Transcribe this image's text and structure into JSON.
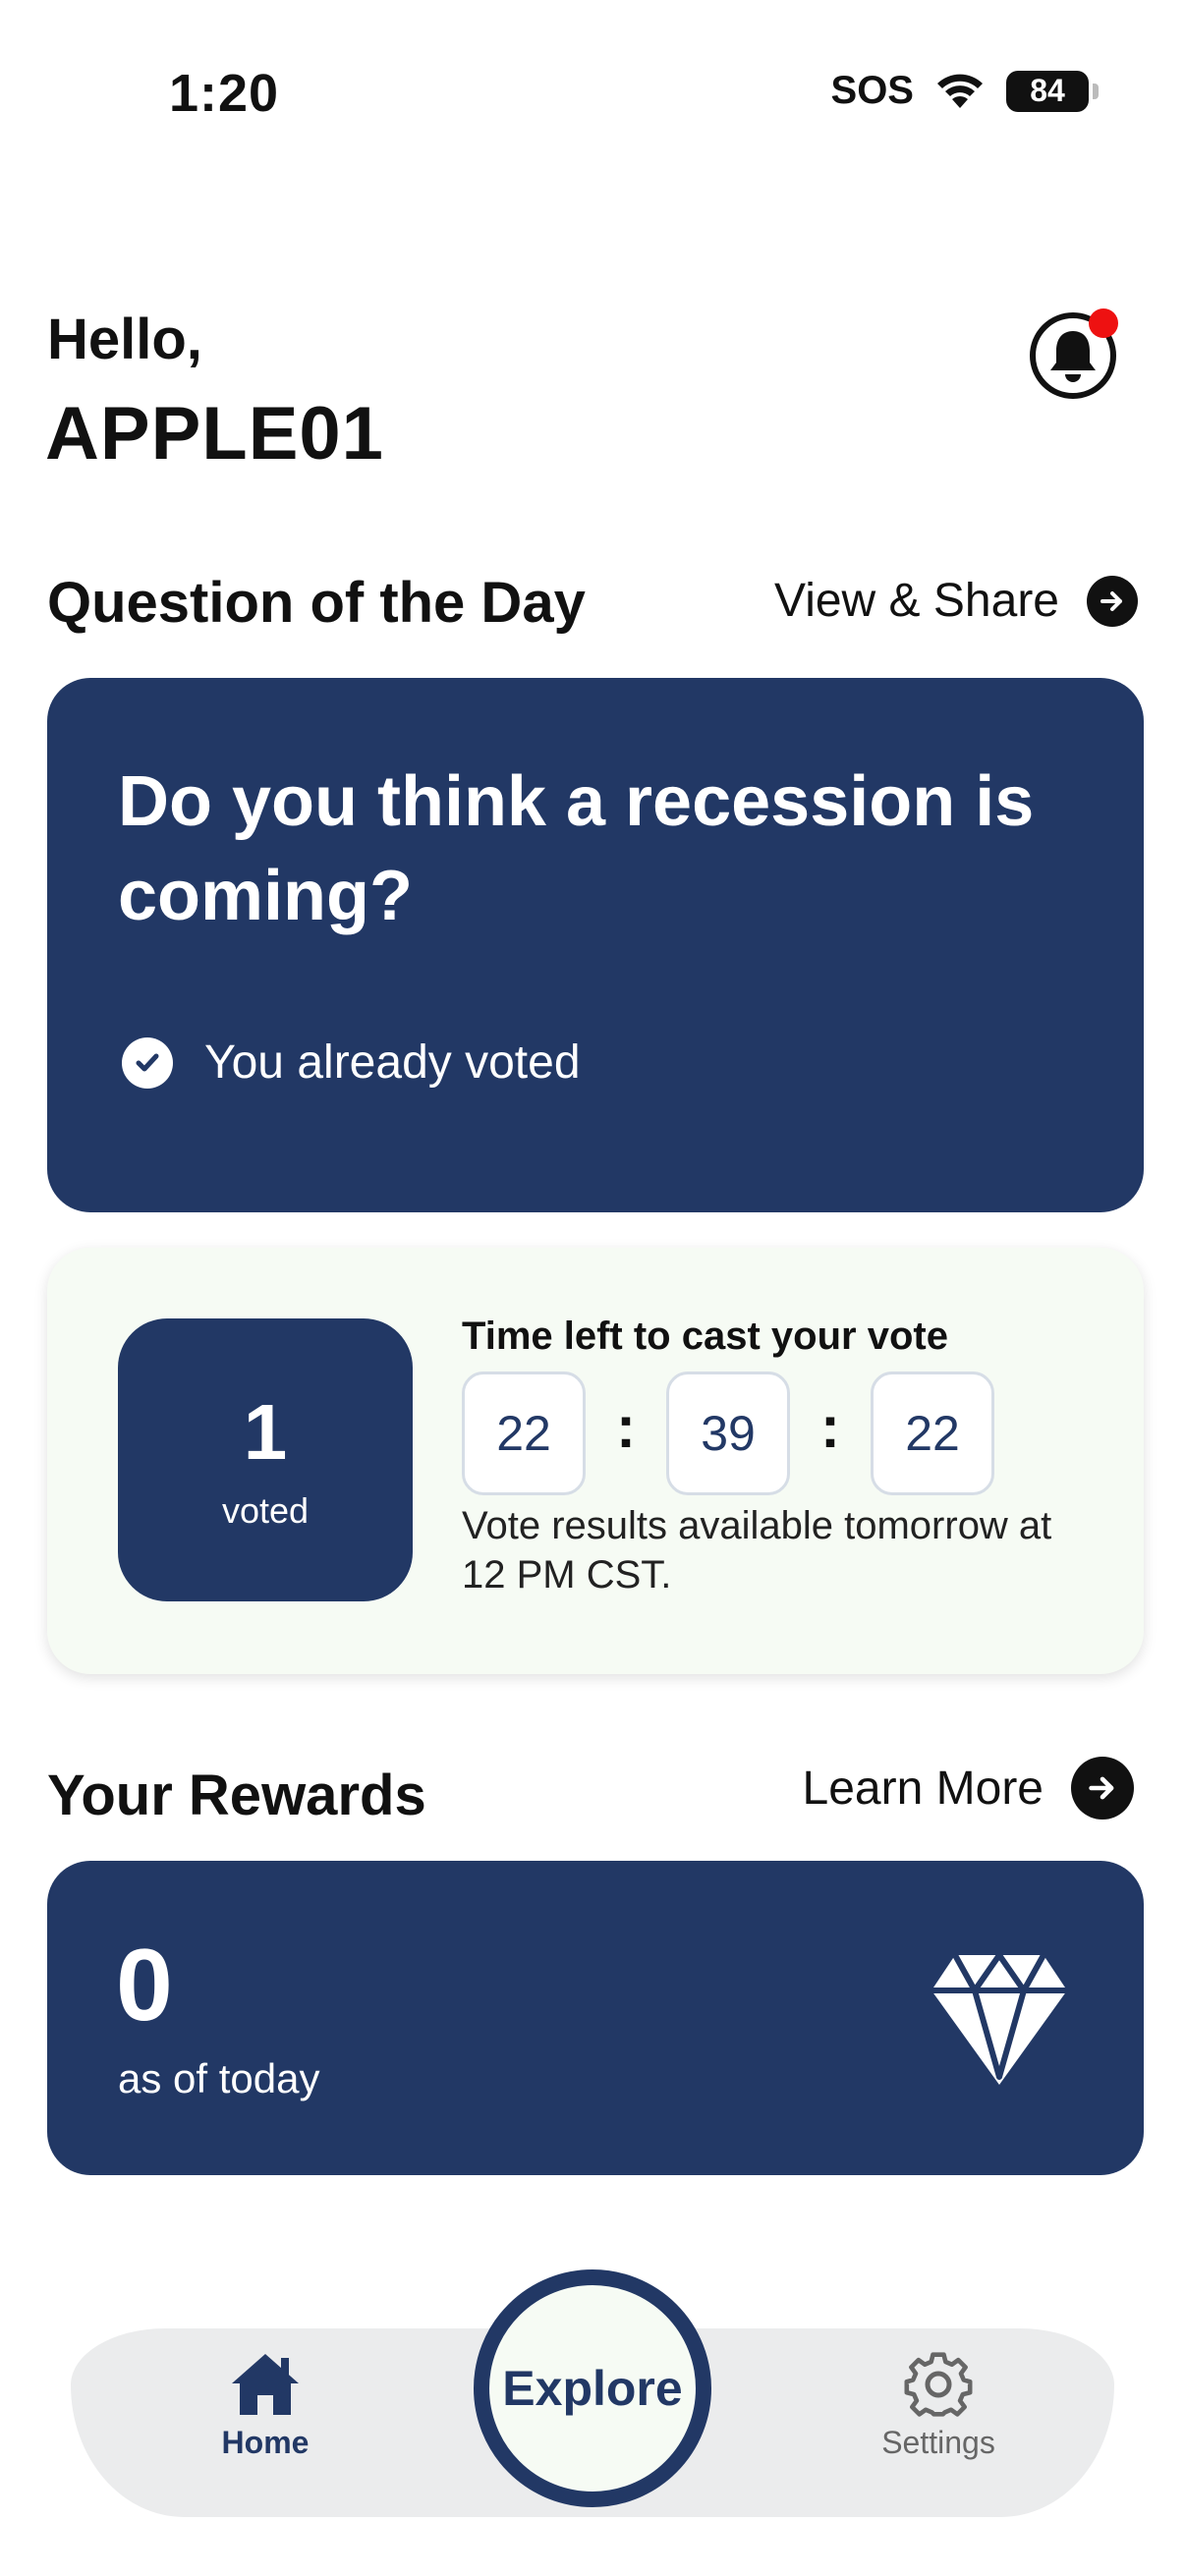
{
  "status_bar": {
    "time": "1:20",
    "sos": "SOS",
    "battery": "84"
  },
  "greeting": {
    "hello": "Hello,",
    "username": "APPLE01"
  },
  "question_section": {
    "title": "Question of the Day",
    "link_label": "View & Share"
  },
  "question_card": {
    "question": "Do you think a recession is coming?",
    "voted_status": "You already voted"
  },
  "countdown_card": {
    "voted_count": "1",
    "voted_label": "voted",
    "time_title": "Time left to cast your vote",
    "hours": "22",
    "minutes": "39",
    "seconds": "22",
    "separator": ":",
    "results_note": "Vote results available tomorrow at 12 PM  CST."
  },
  "rewards_section": {
    "title": "Your Rewards",
    "link_label": "Learn More"
  },
  "rewards_card": {
    "points": "0",
    "points_label": "as of today",
    "icon": "diamond-icon"
  },
  "bottom_nav": {
    "home_label": "Home",
    "explore_label": "Explore",
    "settings_label": "Settings"
  },
  "colors": {
    "navy": "#223865",
    "notification": "#ee1111",
    "mint_bg": "#f6fbf4",
    "nav_bg": "#ebeced"
  }
}
